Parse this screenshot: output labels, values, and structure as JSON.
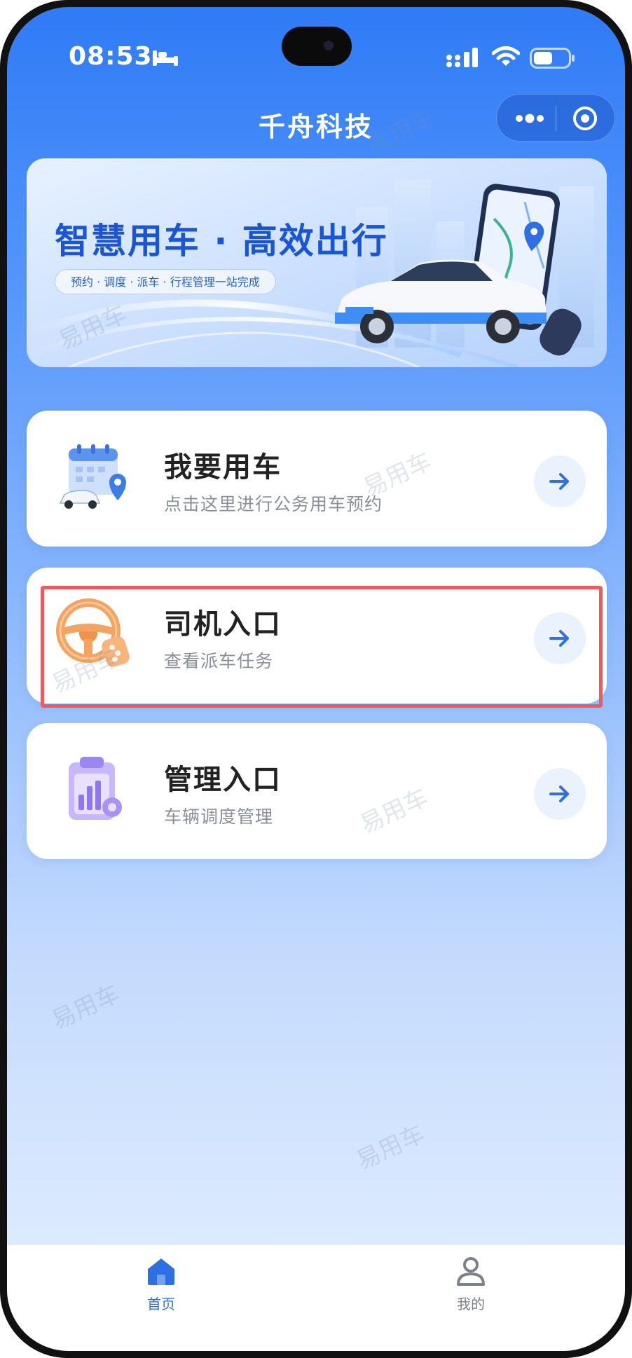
{
  "status_bar": {
    "time": "08:53"
  },
  "nav": {
    "title": "千舟科技"
  },
  "banner": {
    "title": "智慧用车 · 高效出行",
    "subtitle": "预约 · 调度 · 派车 · 行程管理一站完成"
  },
  "cards": [
    {
      "title": "我要用车",
      "desc": "点击这里进行公务用车预约"
    },
    {
      "title": "司机入口",
      "desc": "查看派车任务"
    },
    {
      "title": "管理入口",
      "desc": "车辆调度管理"
    }
  ],
  "watermark": {
    "text": "易用车"
  },
  "tabbar": {
    "items": [
      {
        "label": "首页",
        "icon": "home-icon",
        "active": true
      },
      {
        "label": "我的",
        "icon": "user-icon",
        "active": false
      }
    ]
  },
  "colors": {
    "primary": "#2f6fe4",
    "banner_title": "#1a55d6",
    "highlight": "#ef5a5f"
  }
}
